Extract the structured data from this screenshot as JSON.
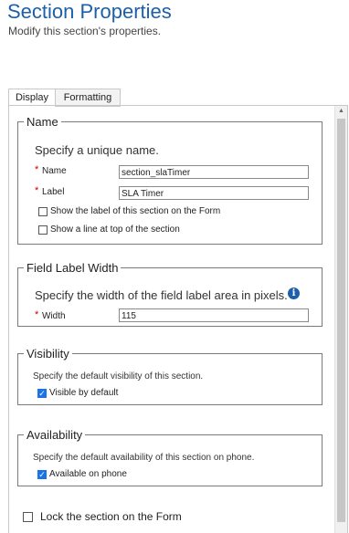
{
  "header": {
    "title": "Section Properties",
    "subtitle": "Modify this section's properties."
  },
  "tabs": [
    {
      "label": "Display",
      "active": true
    },
    {
      "label": "Formatting",
      "active": false
    }
  ],
  "name_group": {
    "legend": "Name",
    "description": "Specify a unique name.",
    "name_label": "Name",
    "name_value": "section_slaTimer",
    "label_label": "Label",
    "label_value": "SLA Timer",
    "show_label_text": "Show the label of this section on the Form",
    "show_label_checked": false,
    "show_line_text": "Show a line at top of the section",
    "show_line_checked": false
  },
  "width_group": {
    "legend": "Field Label Width",
    "description": "Specify the width of the field label area in pixels.",
    "width_label": "Width",
    "width_value": "115"
  },
  "visibility_group": {
    "legend": "Visibility",
    "description": "Specify the default visibility of this section.",
    "visible_text": "Visible by default",
    "visible_checked": true
  },
  "availability_group": {
    "legend": "Availability",
    "description": "Specify the default availability of this section on phone.",
    "phone_text": "Available on phone",
    "phone_checked": true
  },
  "lock": {
    "text": "Lock the section on the Form",
    "checked": false
  },
  "colors": {
    "title": "#1d5fa8",
    "required": "#cc0000",
    "checkbox_checked": "#1a73e8"
  }
}
